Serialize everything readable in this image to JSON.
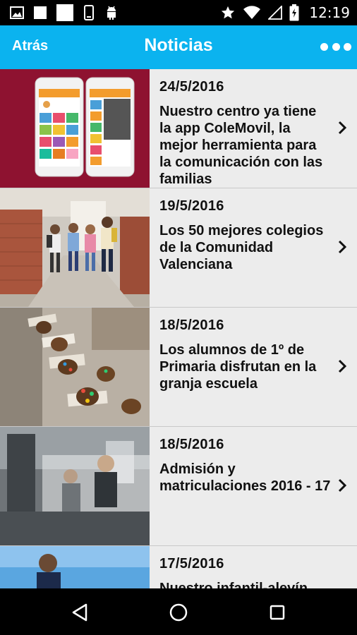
{
  "status_bar": {
    "left_icons": [
      "image-icon",
      "notification-square-icon",
      "notification-square-large-icon",
      "phone-vibrate-icon",
      "android-icon"
    ],
    "right_icons": [
      "star-icon",
      "wifi-icon",
      "signal-icon",
      "battery-charging-icon"
    ],
    "time": "12:19"
  },
  "app_bar": {
    "back_label": "Atrás",
    "title": "Noticias",
    "more_icon": "more-dots-icon"
  },
  "news": [
    {
      "date": "24/5/2016",
      "title": "Nuestro centro ya tiene la app ColeMovil, la mejor herramienta para la comunicación con las familias"
    },
    {
      "date": "19/5/2016",
      "title": "Los 50 mejores colegios de la Comunidad Valenciana"
    },
    {
      "date": "18/5/2016",
      "title": "Los alumnos de 1º de Primaria disfrutan en la granja escuela"
    },
    {
      "date": "18/5/2016",
      "title": "Admisión y matriculaciones 2016 - 17"
    },
    {
      "date": "17/5/2016",
      "title": "Nuestro infantil-alevín"
    }
  ],
  "nav_bar": {
    "buttons": [
      "back-triangle-icon",
      "home-circle-icon",
      "recents-square-icon"
    ]
  },
  "colors": {
    "app_bar": "#0bb3ef",
    "list_background": "#ececec",
    "status_bar": "#000000",
    "text": "#111111"
  }
}
